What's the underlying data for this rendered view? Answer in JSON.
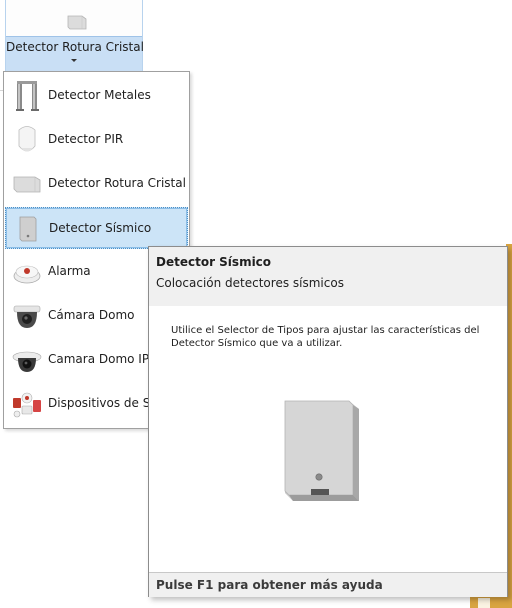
{
  "ribbon": {
    "split_button_label": "Detector Rotura Cristal"
  },
  "menu": {
    "items": [
      {
        "label": "Detector Metales",
        "icon": "metal-detector-icon"
      },
      {
        "label": "Detector PIR",
        "icon": "pir-detector-icon"
      },
      {
        "label": "Detector Rotura Cristal",
        "icon": "glass-break-detector-icon"
      },
      {
        "label": "Detector Sísmico",
        "icon": "seismic-detector-icon",
        "selected": true
      },
      {
        "label": "Alarma",
        "icon": "alarm-icon"
      },
      {
        "label": "Cámara Domo",
        "icon": "dome-camera-icon"
      },
      {
        "label": "Camara Domo IP",
        "icon": "ip-dome-camera-icon"
      },
      {
        "label": "Dispositivos de Seg",
        "icon": "security-devices-icon"
      }
    ]
  },
  "tooltip": {
    "title": "Detector Sísmico",
    "subtitle": "Colocación detectores sísmicos",
    "body": "Utilice el Selector de Tipos para ajustar las características del Detector Sísmico que va a utilizar.",
    "footer": "Pulse F1 para obtener más ayuda"
  },
  "colors": {
    "selection_fill": "#cce4f7",
    "selection_border": "#4a90c8",
    "split_button_highlight": "#c9dff5",
    "background_app_accent": "#d9a441"
  }
}
